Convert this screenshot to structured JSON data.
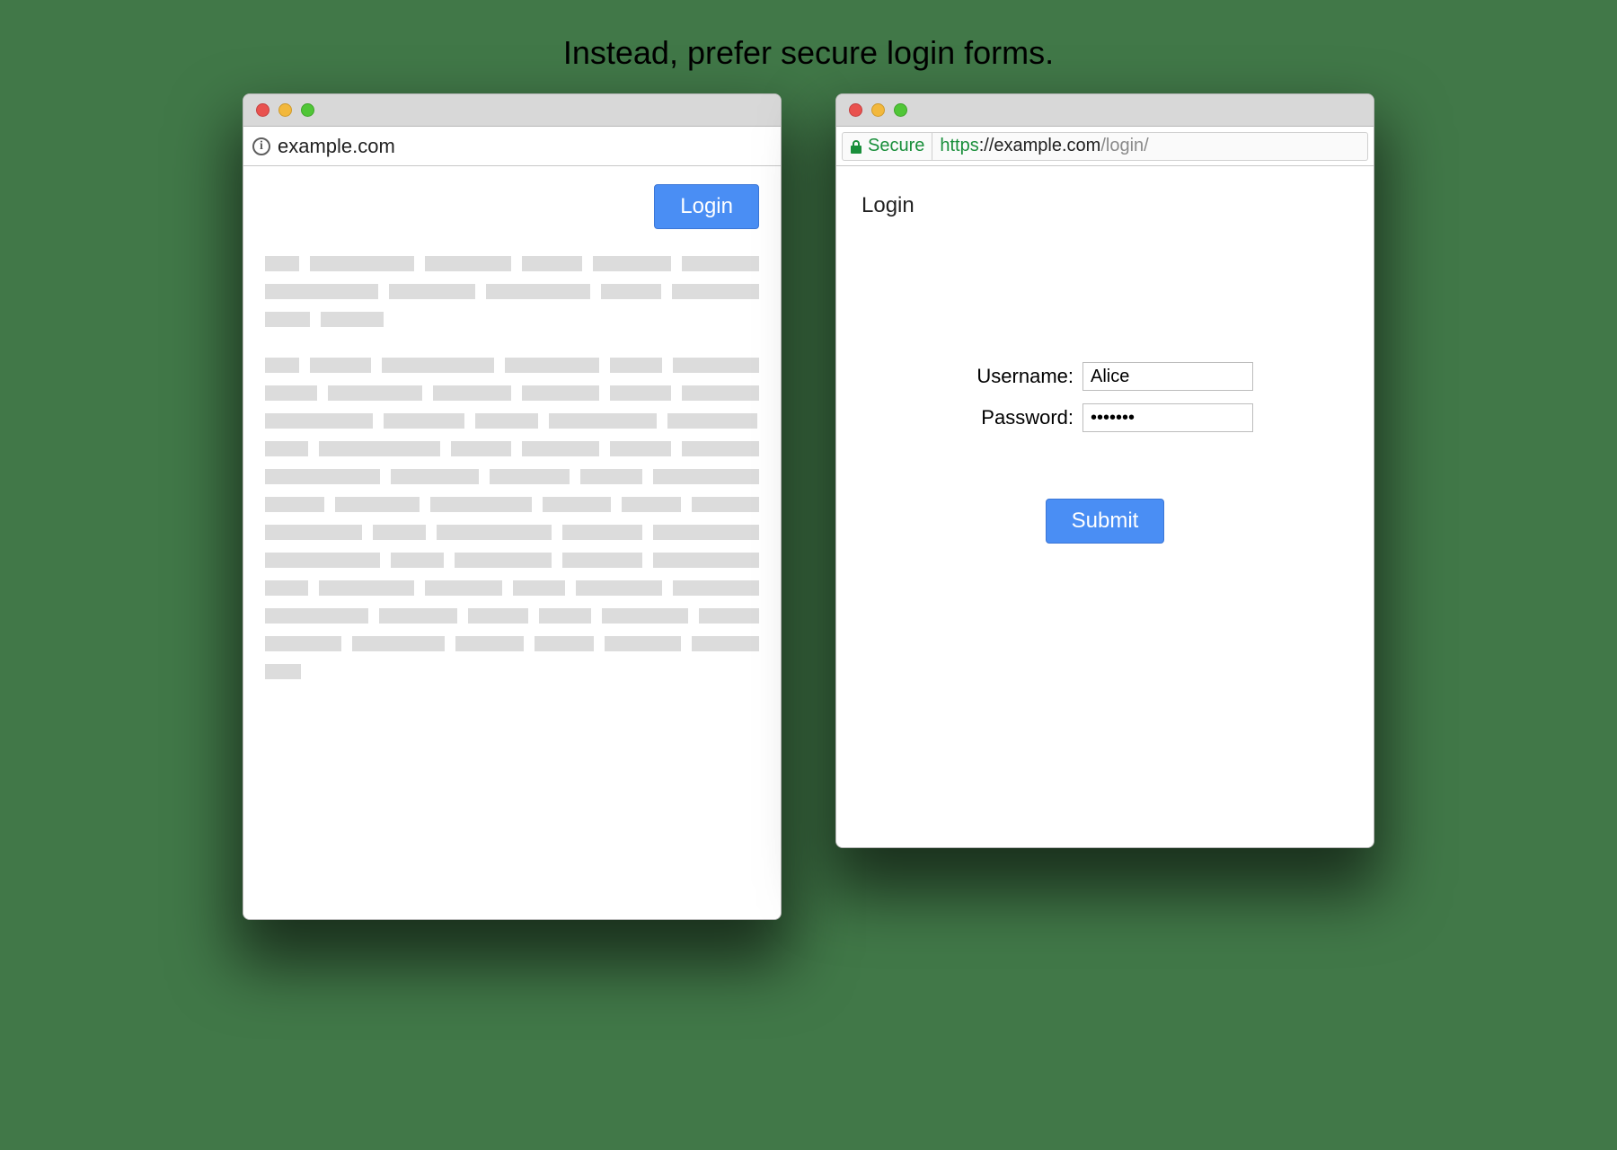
{
  "caption": "Instead, prefer secure login forms.",
  "left_window": {
    "address": "example.com",
    "login_button": "Login"
  },
  "right_window": {
    "secure_label": "Secure",
    "url_scheme": "https",
    "url_host": "://example.com",
    "url_path": "/login/",
    "heading": "Login",
    "username_label": "Username:",
    "username_value": "Alice",
    "password_label": "Password:",
    "password_value": "•••••••",
    "submit_label": "Submit"
  },
  "colors": {
    "primary": "#4a8ef4",
    "secure_green": "#1a8f3b"
  }
}
